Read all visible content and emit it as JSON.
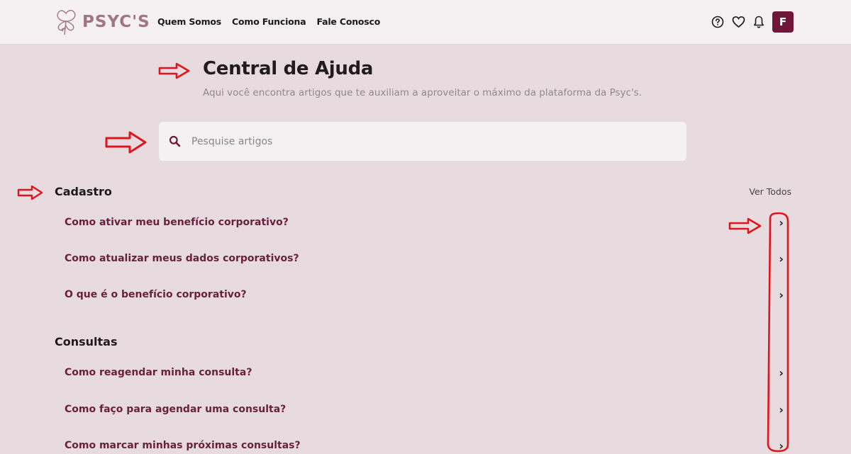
{
  "header": {
    "brand": "PSYC'S",
    "nav_links": [
      "Quem Somos",
      "Como Funciona",
      "Fale Conosco"
    ],
    "avatar_initial": "F"
  },
  "page": {
    "title": "Central de Ajuda",
    "subtitle": "Aqui você encontra artigos que te auxiliam a aproveitar o máximo da plataforma da Psyc's."
  },
  "search": {
    "placeholder": "Pesquise artigos"
  },
  "sections": [
    {
      "title": "Cadastro",
      "see_all": "Ver Todos",
      "articles": [
        "Como ativar meu benefício corporativo?",
        "Como atualizar meus dados corporativos?",
        "O que é o benefício corporativo?"
      ]
    },
    {
      "title": "Consultas",
      "articles": [
        "Como reagendar minha consulta?",
        "Como faço para agendar uma consulta?",
        "Como marcar minhas próximas consultas?"
      ]
    }
  ],
  "colors": {
    "brand": "#a07585",
    "accent": "#6e1736",
    "background": "#e7dbdf",
    "annotation": "#e0141b"
  }
}
